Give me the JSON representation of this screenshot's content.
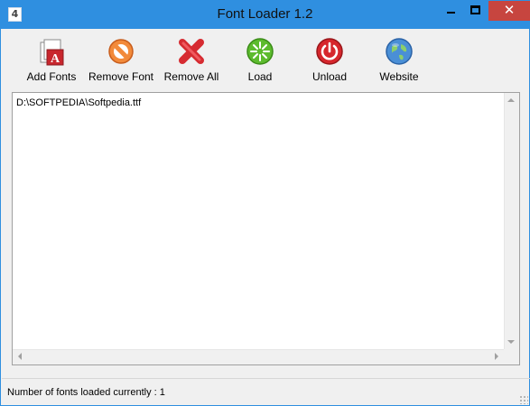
{
  "window": {
    "title": "Font Loader 1.2",
    "app_icon_glyph": "4",
    "close_glyph": "✕",
    "accent_color": "#2f8fe0",
    "close_color": "#c7453f"
  },
  "toolbar": {
    "add_fonts": {
      "label": "Add Fonts",
      "icon": "font-file-icon"
    },
    "remove_font": {
      "label": "Remove Font",
      "icon": "remove-circle-icon"
    },
    "remove_all": {
      "label": "Remove All",
      "icon": "red-x-icon"
    },
    "load": {
      "label": "Load",
      "icon": "green-sparkle-icon"
    },
    "unload": {
      "label": "Unload",
      "icon": "power-icon"
    },
    "website": {
      "label": "Website",
      "icon": "globe-icon"
    }
  },
  "font_list": {
    "items": [
      "D:\\SOFTPEDIA\\Softpedia.ttf"
    ]
  },
  "status": {
    "text": "Number of fonts loaded currently : 1"
  }
}
